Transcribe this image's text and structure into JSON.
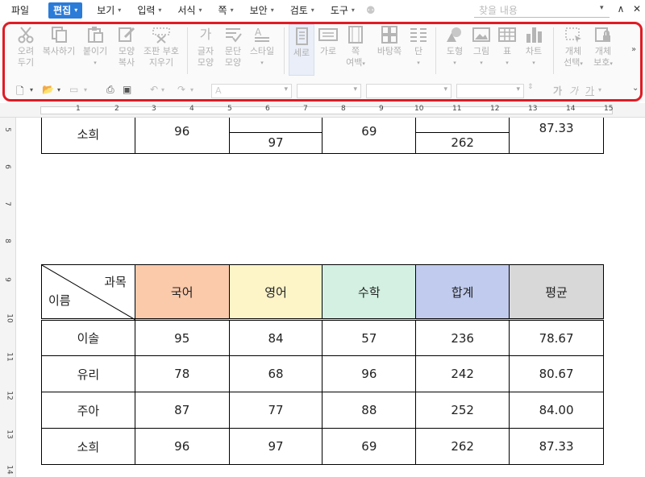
{
  "menu": {
    "items": [
      {
        "label": "파일",
        "arrow": false
      },
      {
        "label": "편집",
        "arrow": true,
        "active": true
      },
      {
        "label": "보기",
        "arrow": true
      },
      {
        "label": "입력",
        "arrow": true
      },
      {
        "label": "서식",
        "arrow": true
      },
      {
        "label": "쪽",
        "arrow": true
      },
      {
        "label": "보안",
        "arrow": true
      },
      {
        "label": "검토",
        "arrow": true
      },
      {
        "label": "도구",
        "arrow": true
      }
    ],
    "search_placeholder": "찾을 내용"
  },
  "ribbon": {
    "tools": [
      {
        "id": "cut",
        "lines": [
          "오려",
          "두기"
        ]
      },
      {
        "id": "copy",
        "lines": [
          "복사하기"
        ]
      },
      {
        "id": "paste",
        "lines": [
          "붙이기"
        ]
      },
      {
        "id": "format-copy",
        "lines": [
          "모양",
          "복사"
        ]
      },
      {
        "id": "clear-format",
        "lines": [
          "조판 부호",
          "지우기"
        ]
      },
      {
        "id": "char-shape",
        "lines": [
          "글자",
          "모양"
        ]
      },
      {
        "id": "para-shape",
        "lines": [
          "문단",
          "모양"
        ]
      },
      {
        "id": "style",
        "lines": [
          "스타일"
        ]
      },
      {
        "id": "portrait",
        "lines": [
          "세로"
        ]
      },
      {
        "id": "landscape",
        "lines": [
          "가로"
        ]
      },
      {
        "id": "margin",
        "lines": [
          "쪽",
          "여백"
        ]
      },
      {
        "id": "background",
        "lines": [
          "바탕쪽"
        ]
      },
      {
        "id": "column",
        "lines": [
          "단"
        ]
      },
      {
        "id": "shape",
        "lines": [
          "도형"
        ]
      },
      {
        "id": "picture",
        "lines": [
          "그림"
        ]
      },
      {
        "id": "table",
        "lines": [
          "표"
        ]
      },
      {
        "id": "chart",
        "lines": [
          "차트"
        ]
      },
      {
        "id": "object-select",
        "lines": [
          "개체",
          "선택"
        ]
      },
      {
        "id": "object-protect",
        "lines": [
          "개체",
          "보호"
        ]
      }
    ],
    "char_buttons": [
      "가",
      "가",
      "가"
    ]
  },
  "ruler": {
    "h_numbers": [
      "1",
      "2",
      "3",
      "4",
      "5",
      "6",
      "7",
      "8",
      "9",
      "10",
      "11",
      "12",
      "13",
      "14",
      "15"
    ],
    "v_numbers": [
      "5",
      "6",
      "7",
      "8",
      "9",
      "10",
      "11",
      "12",
      "13",
      "14"
    ]
  },
  "document": {
    "partial_table": {
      "row": [
        "소희",
        "96",
        "97",
        "69",
        "262",
        "87.33"
      ]
    },
    "grade_table": {
      "corner": {
        "top_right": "과목",
        "bottom_left": "이름"
      },
      "headers": [
        {
          "label": "국어",
          "color": "#fbcaab"
        },
        {
          "label": "영어",
          "color": "#fdf4c8"
        },
        {
          "label": "수학",
          "color": "#d3f0e2"
        },
        {
          "label": "합계",
          "color": "#c0cbee"
        },
        {
          "label": "평균",
          "color": "#d8d8d8"
        }
      ],
      "rows": [
        [
          "이솔",
          "95",
          "84",
          "57",
          "236",
          "78.67"
        ],
        [
          "유리",
          "78",
          "68",
          "96",
          "242",
          "80.67"
        ],
        [
          "주아",
          "87",
          "77",
          "88",
          "252",
          "84.00"
        ],
        [
          "소희",
          "96",
          "97",
          "69",
          "262",
          "87.33"
        ]
      ]
    }
  },
  "colors": {
    "accent": "#2b7bd8",
    "highlight_frame": "#e01b24"
  }
}
